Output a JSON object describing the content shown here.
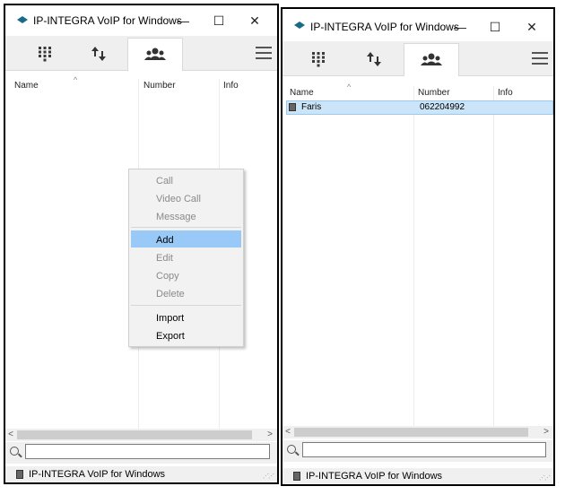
{
  "window": {
    "title": "IP-INTEGRA VoIP for Windows",
    "minimize_glyph": "—",
    "maximize_glyph": "☐",
    "close_glyph": "✕"
  },
  "toolbar": {
    "tabs": [
      {
        "icon": "dialpad-icon"
      },
      {
        "icon": "call-history-icon"
      },
      {
        "icon": "contacts-icon",
        "active": true
      }
    ],
    "menu_icon": "hamburger-menu-icon"
  },
  "columns": {
    "name": "Name",
    "number": "Number",
    "info": "Info",
    "sort_indicator": "^"
  },
  "contacts": [
    {
      "name": "Faris",
      "number": "062204992",
      "info": ""
    }
  ],
  "context_menu": {
    "items": [
      {
        "label": "Call",
        "enabled": false
      },
      {
        "label": "Video Call",
        "enabled": false
      },
      {
        "label": "Message",
        "enabled": false
      },
      {
        "label": "Add",
        "enabled": true,
        "highlighted": true
      },
      {
        "label": "Edit",
        "enabled": false
      },
      {
        "label": "Copy",
        "enabled": false
      },
      {
        "label": "Delete",
        "enabled": false
      },
      {
        "label": "Import",
        "enabled": true
      },
      {
        "label": "Export",
        "enabled": true
      }
    ]
  },
  "scrollbar": {
    "left_arrow": "<",
    "right_arrow": ">"
  },
  "search": {
    "value": "",
    "placeholder": ""
  },
  "statusbar": {
    "text": "IP-INTEGRA VoIP for Windows"
  },
  "colors": {
    "accent": "#1a6a8a",
    "selection": "#cce4f7",
    "menu_highlight": "#99c9f7"
  }
}
